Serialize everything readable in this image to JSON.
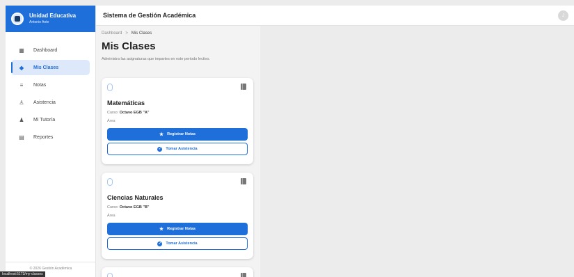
{
  "brand": {
    "name": "Unidad Educativa",
    "user": "Antonio Ante"
  },
  "header": {
    "title": "Sistema de Gestión Académica",
    "avatar_initial": "J"
  },
  "sidebar": {
    "items": [
      {
        "label": "Dashboard",
        "icon": "dashboard-icon"
      },
      {
        "label": "Mis Clases",
        "icon": "graduation-cap-icon",
        "active": true
      },
      {
        "label": "Notas",
        "icon": "notes-icon"
      },
      {
        "label": "Asistencia",
        "icon": "attendance-icon"
      },
      {
        "label": "Mi Tutoría",
        "icon": "people-icon"
      },
      {
        "label": "Reportes",
        "icon": "chart-icon"
      }
    ],
    "footer": "© 2026 Gestión Académica"
  },
  "status_url": "localhost:5173/my-classes",
  "breadcrumb": {
    "root": "Dashboard",
    "separator": ">",
    "current": "Mis Clases"
  },
  "page": {
    "title": "Mis Clases",
    "subtitle": "Administra las asignaturas que impartes en este periodo lectivo."
  },
  "classes": [
    {
      "subject": "Matemáticas",
      "course_label": "Curso:",
      "course": "Octavo EGB \"A\"",
      "area": "Área",
      "register_label": "Registrar Notas",
      "attendance_label": "Tomar Asistencia"
    },
    {
      "subject": "Ciencias Naturales",
      "course_label": "Curso:",
      "course": "Octavo EGB \"B\"",
      "area": "Área",
      "register_label": "Registrar Notas",
      "attendance_label": "Tomar Asistencia"
    }
  ],
  "colors": {
    "accent": "#1e6fd9",
    "active_bg": "#dde9fb"
  }
}
